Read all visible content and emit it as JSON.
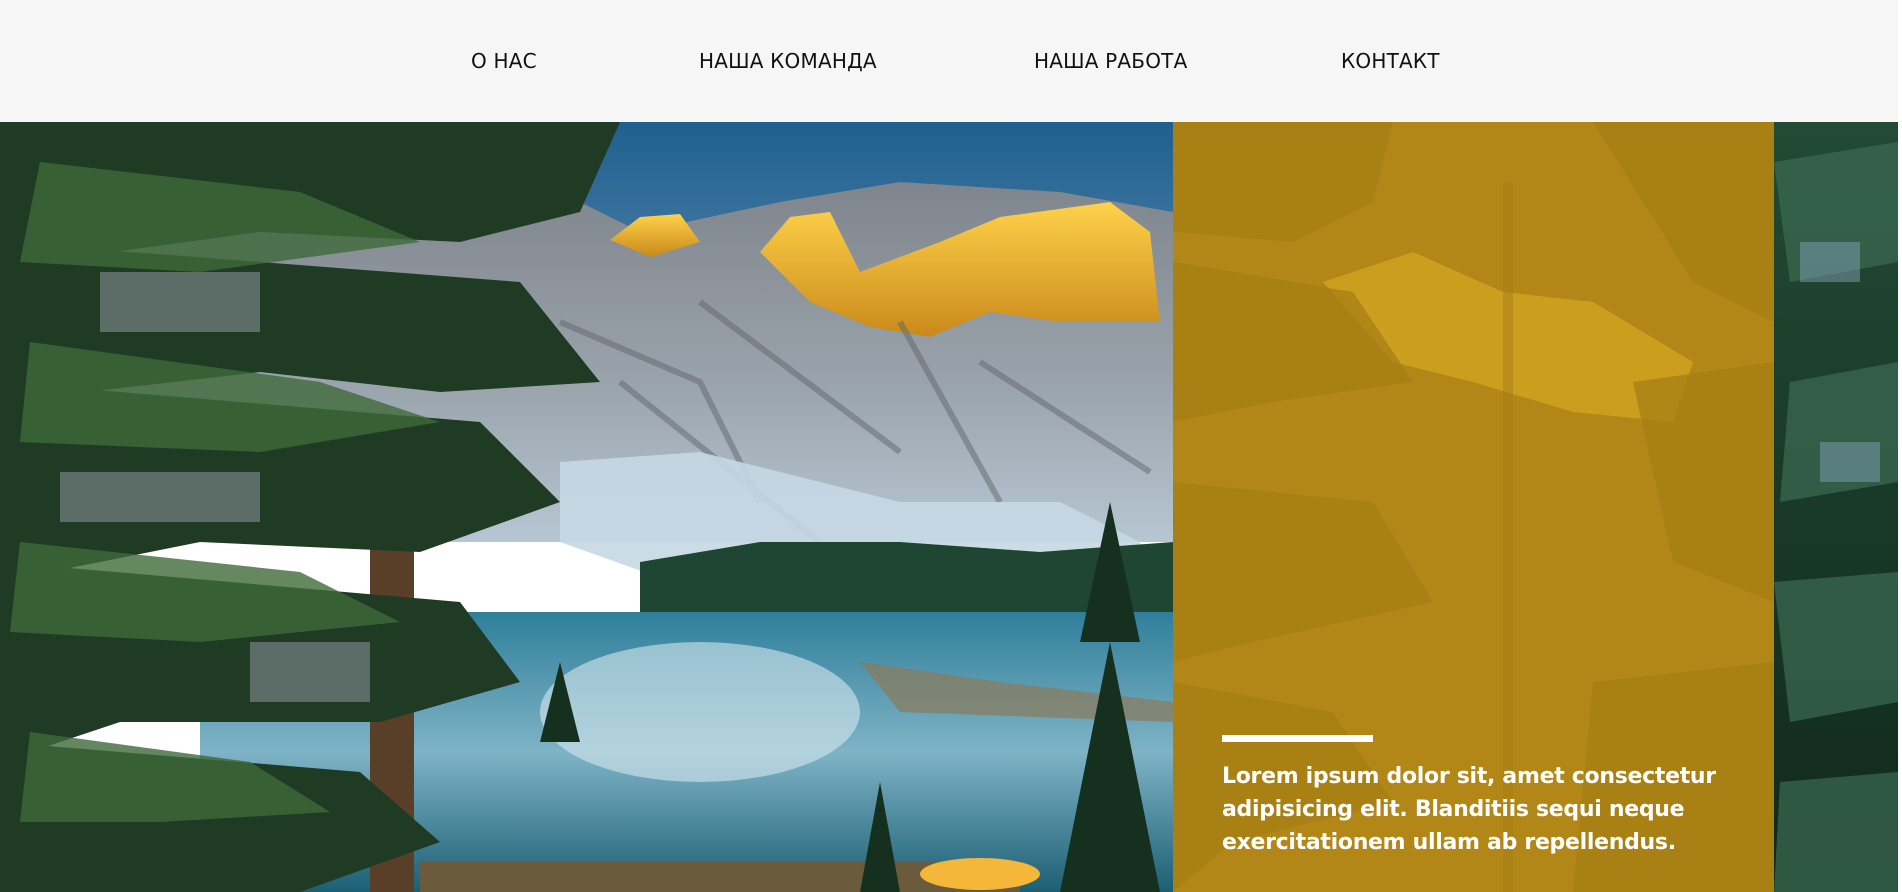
{
  "nav": {
    "items": [
      {
        "label": "О НАС"
      },
      {
        "label": "НАША КОМАНДА"
      },
      {
        "label": "НАША РАБОТА"
      },
      {
        "label": "КОНТАКТ"
      }
    ]
  },
  "hero": {
    "image": "mountain-lake-forest-photo",
    "overlay": {
      "text": "Lorem ipsum dolor sit, amet consectetur adipisicing elit. Blanditiis sequi neque exercitationem ullam ab repellendus.",
      "color": "#be8f12"
    }
  },
  "colors": {
    "nav_background": "#f6f6f6",
    "nav_text": "#111111",
    "overlay_yellow": "#be8f12",
    "overlay_text": "#ffffff"
  }
}
